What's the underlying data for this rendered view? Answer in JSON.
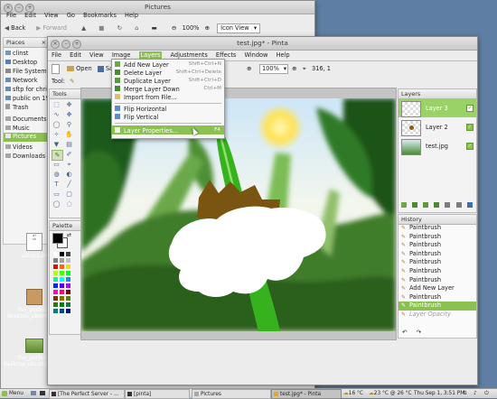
{
  "nautilus": {
    "title": "Pictures",
    "menu": [
      "File",
      "Edit",
      "View",
      "Go",
      "Bookmarks",
      "Help"
    ],
    "toolbar": {
      "back": "Back",
      "forward": "Forward",
      "zoom": "100%",
      "view": "Icon View"
    },
    "places_header": "Places",
    "places": [
      "clinst",
      "Desktop",
      "File System",
      "Network",
      "sftp for chris...",
      "public on 19...",
      "Trash",
      "Documents",
      "Music",
      "Pictures",
      "Videos",
      "Downloads"
    ]
  },
  "desktop": {
    "icons": [
      {
        "label": "setup1.sh",
        "line2": ""
      },
      {
        "label": "the_perfect_",
        "line2": "desktop_ubuntu_11.zip"
      },
      {
        "label": "the_perfect_",
        "line2": "desktop_ubuntu_11.pdf"
      }
    ]
  },
  "pinta": {
    "title": "test.jpg* - Pinta",
    "menu": [
      "File",
      "Edit",
      "View",
      "Image",
      "Layers",
      "Adjustments",
      "Effects",
      "Window",
      "Help"
    ],
    "toolbar": {
      "open": "Open",
      "save": "Save",
      "zoom": "100%",
      "coords": "316, 1"
    },
    "tool_label": "Tool:",
    "tools_header": "Tools",
    "palette_header": "Palette",
    "layers_header": "Layers",
    "layers": [
      "Layer 3",
      "Layer 2",
      "test.jpg"
    ],
    "history_header": "History",
    "history": [
      "Paintbrush",
      "Paintbrush",
      "Paintbrush",
      "Paintbrush",
      "Paintbrush",
      "Paintbrush",
      "Paintbrush",
      "Add New Layer",
      "Paintbrush",
      "Paintbrush",
      "Layer Opacity"
    ]
  },
  "layers_menu": {
    "items": [
      {
        "label": "Add New Layer",
        "shortcut": "Shift+Ctrl+N"
      },
      {
        "label": "Delete Layer",
        "shortcut": "Shift+Ctrl+Delete"
      },
      {
        "label": "Duplicate Layer",
        "shortcut": "Shift+Ctrl+D"
      },
      {
        "label": "Merge Layer Down",
        "shortcut": "Ctrl+M"
      },
      {
        "label": "Import from File...",
        "shortcut": ""
      },
      {
        "label": "Flip Horizontal",
        "shortcut": ""
      },
      {
        "label": "Flip Vertical",
        "shortcut": ""
      },
      {
        "label": "Layer Properties...",
        "shortcut": "F4"
      }
    ]
  },
  "taskbar": {
    "menu": "Menu",
    "tasks": [
      "[The Perfect Server - ...",
      "[pinta]",
      "Pictures",
      "test.jpg* - Pinta"
    ],
    "weather1": "16 °C",
    "weather2": "23 °C @ 26 °C",
    "clock": "Thu Sep 1,  3:51 PM"
  },
  "colors": {
    "accent": "#8cc152",
    "desktop_bg": "#5e7fa3",
    "taskbar": "#dcdcdc"
  }
}
